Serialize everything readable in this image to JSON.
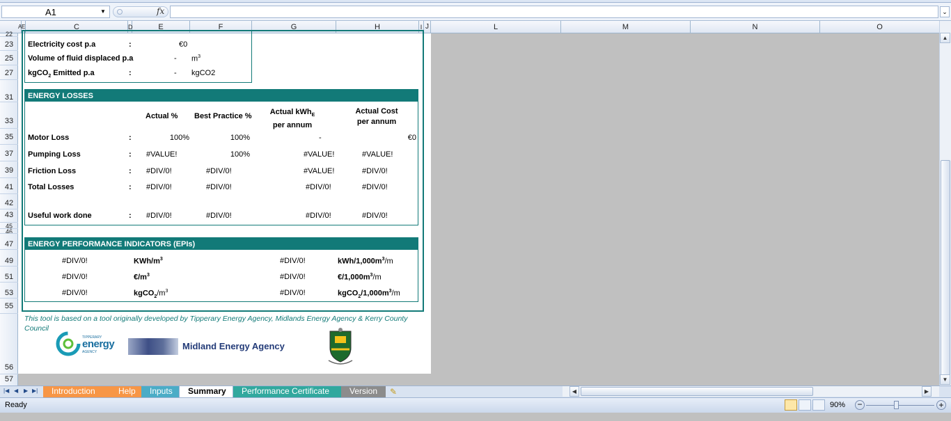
{
  "namebox": {
    "value": "A1"
  },
  "formula": {
    "fx": "fx",
    "value": ""
  },
  "columns": [
    "A",
    "E",
    "C",
    "D",
    "E",
    "F",
    "G",
    "H",
    "I",
    "J",
    "L",
    "M",
    "N",
    "O"
  ],
  "rows": [
    "22",
    "23",
    "25",
    "27",
    "31",
    "33",
    "35",
    "37",
    "39",
    "41",
    "42",
    "43",
    "45",
    "46",
    "47",
    "49",
    "51",
    "53",
    "55",
    "56",
    "57"
  ],
  "top_block": {
    "electricity_label": "Electricity cost p.a",
    "electricity_colon": ":",
    "electricity_value": "€0",
    "volume_label": "Volume of fluid displaced p.a",
    "volume_colon": ":",
    "volume_value": "-",
    "volume_unit": "m",
    "volume_unit_sup": "3",
    "kgco2_label_a": "kgCO",
    "kgco2_label_sub": "2",
    "kgco2_label_b": " Emitted p.a",
    "kgco2_colon": ":",
    "kgco2_value": "-",
    "kgco2_unit": "kgCO2"
  },
  "energy_losses": {
    "title": "ENERGY LOSSES",
    "headers": {
      "actual": "Actual %",
      "best": "Best Practice %",
      "kwh_a": "Actual kWh",
      "kwh_sub": "E",
      "kwh_b": "per annum",
      "cost_a": "Actual Cost",
      "cost_b": "per annum"
    },
    "rows": [
      {
        "label": "Motor Loss",
        "colon": ":",
        "actual": "100%",
        "best": "100%",
        "kwh": "-",
        "cost": "€0"
      },
      {
        "label": "Pumping Loss",
        "colon": ":",
        "actual": "#VALUE!",
        "best": "100%",
        "kwh": "#VALUE!",
        "cost": "#VALUE!"
      },
      {
        "label": "Friction Loss",
        "colon": ":",
        "actual": "#DIV/0!",
        "best": "#DIV/0!",
        "kwh": "#VALUE!",
        "cost": "#DIV/0!"
      },
      {
        "label": "Total Losses",
        "colon": ":",
        "actual": "#DIV/0!",
        "best": "#DIV/0!",
        "kwh": "#DIV/0!",
        "cost": "#DIV/0!"
      },
      {
        "label": "Useful work done",
        "colon": ":",
        "actual": "#DIV/0!",
        "best": "#DIV/0!",
        "kwh": "#DIV/0!",
        "cost": "#DIV/0!"
      }
    ]
  },
  "epis": {
    "title": "ENERGY PERFORMANCE INDICATORS (EPIs)",
    "rows": [
      {
        "v1": "#DIV/0!",
        "u1a": "KWh/m",
        "u1sup": "3",
        "u1sub": "",
        "u1b": "",
        "v2": "#DIV/0!",
        "u2a": "kWh/1,000m",
        "u2sup": "3",
        "u2sub": "",
        "u2b": "/m"
      },
      {
        "v1": "#DIV/0!",
        "u1a": "€/m",
        "u1sup": "3",
        "u1sub": "",
        "u1b": "",
        "v2": "#DIV/0!",
        "u2a": "€/1,000m",
        "u2sup": "3",
        "u2sub": "",
        "u2b": "/m"
      },
      {
        "v1": "#DIV/0!",
        "u1a": "kgCO",
        "u1sup": "3",
        "u1sub": "2",
        "u1b": "/m",
        "v2": "#DIV/0!",
        "u2a": "kgCO",
        "u2sup": "3",
        "u2sub": "2",
        "u2b": "/1,000m"
      }
    ]
  },
  "note": "This tool is based on a tool originally developed by Tipperary Energy Agency, Midlands Energy Agency & Kerry County Council",
  "logos": {
    "tipperary_small": "TIPPERARY",
    "tipperary_main": "energy",
    "tipperary_agency": "AGENCY",
    "midland": "Midland Energy Agency"
  },
  "tabs": [
    {
      "label": "Introduction",
      "color": "#f79646"
    },
    {
      "label": "Help",
      "color": "#f79646"
    },
    {
      "label": "Inputs",
      "color": "#4bacc6"
    },
    {
      "label": "Summary",
      "color": "#ffffff"
    },
    {
      "label": "Performance Certificate",
      "color": "#31a89e"
    },
    {
      "label": "Version",
      "color": "#8c8c8c"
    }
  ],
  "status": {
    "ready": "Ready",
    "zoom": "90%"
  },
  "colors": {
    "teal": "#127a78",
    "grid": "#c0c0c0"
  }
}
